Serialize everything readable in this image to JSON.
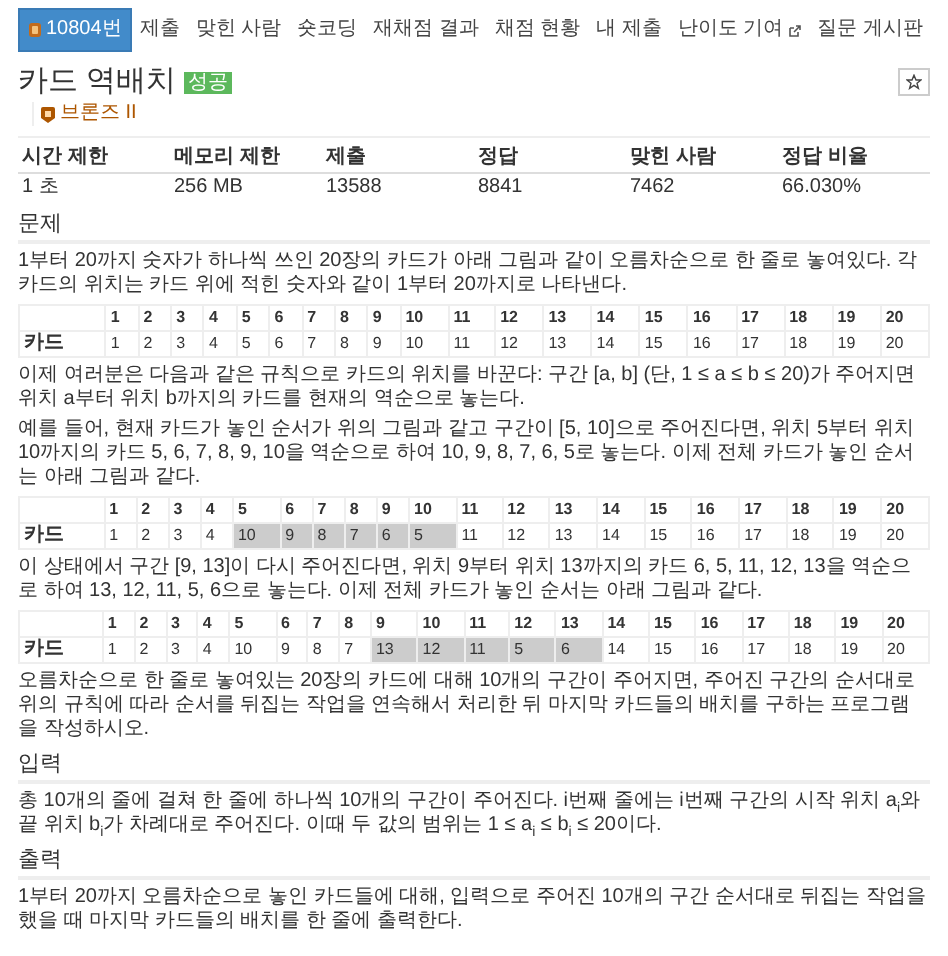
{
  "nav": [
    {
      "label": "10804번",
      "selected": true,
      "external": false
    },
    {
      "label": "제출",
      "selected": false,
      "external": false
    },
    {
      "label": "맞힌 사람",
      "selected": false,
      "external": false
    },
    {
      "label": "숏코딩",
      "selected": false,
      "external": false
    },
    {
      "label": "재채점 결과",
      "selected": false,
      "external": false
    },
    {
      "label": "채점 현황",
      "selected": false,
      "external": false
    },
    {
      "label": "내 제출",
      "selected": false,
      "external": false
    },
    {
      "label": "난이도 기여",
      "selected": false,
      "external": true
    },
    {
      "label": "질문 게시판",
      "selected": false,
      "external": false
    }
  ],
  "problem": {
    "title": "카드 역배치",
    "badge": "성공",
    "tier": "브론즈 II"
  },
  "stats": {
    "columns": [
      "시간 제한",
      "메모리 제한",
      "제출",
      "정답",
      "맞힌 사람",
      "정답 비율"
    ],
    "values": [
      "1 초",
      "256 MB",
      "13588",
      "8841",
      "7462",
      "66.030%"
    ]
  },
  "sections": [
    {
      "heading": "문제",
      "blocks": [
        {
          "kind": "paragraph",
          "text": "1부터 20까지 숫자가 하나씩 쓰인 20장의 카드가 아래 그림과 같이 오름차순으로 한 줄로 놓여있다. 각 카드의 위치는 카드 위에 적힌 숫자와 같이 1부터 20까지로 나타낸다."
        },
        {
          "kind": "table",
          "header": [
            "1",
            "2",
            "3",
            "4",
            "5",
            "6",
            "7",
            "8",
            "9",
            "10",
            "11",
            "12",
            "13",
            "14",
            "15",
            "16",
            "17",
            "18",
            "19",
            "20"
          ],
          "row_label": "카드",
          "cells": [
            {
              "text": "1",
              "highlighted": false
            },
            {
              "text": "2",
              "highlighted": false
            },
            {
              "text": "3",
              "highlighted": false
            },
            {
              "text": "4",
              "highlighted": false
            },
            {
              "text": "5",
              "highlighted": false
            },
            {
              "text": "6",
              "highlighted": false
            },
            {
              "text": "7",
              "highlighted": false
            },
            {
              "text": "8",
              "highlighted": false
            },
            {
              "text": "9",
              "highlighted": false
            },
            {
              "text": "10",
              "highlighted": false
            },
            {
              "text": "11",
              "highlighted": false
            },
            {
              "text": "12",
              "highlighted": false
            },
            {
              "text": "13",
              "highlighted": false
            },
            {
              "text": "14",
              "highlighted": false
            },
            {
              "text": "15",
              "highlighted": false
            },
            {
              "text": "16",
              "highlighted": false
            },
            {
              "text": "17",
              "highlighted": false
            },
            {
              "text": "18",
              "highlighted": false
            },
            {
              "text": "19",
              "highlighted": false
            },
            {
              "text": "20",
              "highlighted": false
            }
          ]
        },
        {
          "kind": "paragraph",
          "text": "이제 여러분은 다음과 같은 규칙으로 카드의 위치를 바꾼다: 구간 [a, b] (단, 1 ≤ a ≤ b ≤ 20)가 주어지면 위치 a부터 위치 b까지의 카드를 현재의 역순으로 놓는다."
        },
        {
          "kind": "paragraph",
          "text": "예를 들어, 현재 카드가 놓인 순서가 위의 그림과 같고 구간이 [5, 10]으로 주어진다면, 위치 5부터 위치 10까지의 카드 5, 6, 7, 8, 9, 10을 역순으로 하여 10, 9, 8, 7, 6, 5로 놓는다. 이제 전체 카드가 놓인 순서는 아래 그림과 같다."
        },
        {
          "kind": "table",
          "header": [
            "1",
            "2",
            "3",
            "4",
            "5",
            "6",
            "7",
            "8",
            "9",
            "10",
            "11",
            "12",
            "13",
            "14",
            "15",
            "16",
            "17",
            "18",
            "19",
            "20"
          ],
          "row_label": "카드",
          "cells": [
            {
              "text": "1",
              "highlighted": false
            },
            {
              "text": "2",
              "highlighted": false
            },
            {
              "text": "3",
              "highlighted": false
            },
            {
              "text": "4",
              "highlighted": false
            },
            {
              "text": "10",
              "highlighted": true
            },
            {
              "text": "9",
              "highlighted": true
            },
            {
              "text": "8",
              "highlighted": true
            },
            {
              "text": "7",
              "highlighted": true
            },
            {
              "text": "6",
              "highlighted": true
            },
            {
              "text": "5",
              "highlighted": true
            },
            {
              "text": "11",
              "highlighted": false
            },
            {
              "text": "12",
              "highlighted": false
            },
            {
              "text": "13",
              "highlighted": false
            },
            {
              "text": "14",
              "highlighted": false
            },
            {
              "text": "15",
              "highlighted": false
            },
            {
              "text": "16",
              "highlighted": false
            },
            {
              "text": "17",
              "highlighted": false
            },
            {
              "text": "18",
              "highlighted": false
            },
            {
              "text": "19",
              "highlighted": false
            },
            {
              "text": "20",
              "highlighted": false
            }
          ]
        },
        {
          "kind": "paragraph",
          "text": "이 상태에서 구간 [9, 13]이 다시 주어진다면, 위치 9부터 위치 13까지의 카드 6, 5, 11, 12, 13을 역순으로 하여 13, 12, 11, 5, 6으로 놓는다. 이제 전체 카드가 놓인 순서는 아래 그림과 같다."
        },
        {
          "kind": "table",
          "header": [
            "1",
            "2",
            "3",
            "4",
            "5",
            "6",
            "7",
            "8",
            "9",
            "10",
            "11",
            "12",
            "13",
            "14",
            "15",
            "16",
            "17",
            "18",
            "19",
            "20"
          ],
          "row_label": "카드",
          "cells": [
            {
              "text": "1",
              "highlighted": false
            },
            {
              "text": "2",
              "highlighted": false
            },
            {
              "text": "3",
              "highlighted": false
            },
            {
              "text": "4",
              "highlighted": false
            },
            {
              "text": "10",
              "highlighted": false
            },
            {
              "text": "9",
              "highlighted": false
            },
            {
              "text": "8",
              "highlighted": false
            },
            {
              "text": "7",
              "highlighted": false
            },
            {
              "text": "13",
              "highlighted": true
            },
            {
              "text": "12",
              "highlighted": true
            },
            {
              "text": "11",
              "highlighted": true
            },
            {
              "text": "5",
              "highlighted": true
            },
            {
              "text": "6",
              "highlighted": true
            },
            {
              "text": "14",
              "highlighted": false
            },
            {
              "text": "15",
              "highlighted": false
            },
            {
              "text": "16",
              "highlighted": false
            },
            {
              "text": "17",
              "highlighted": false
            },
            {
              "text": "18",
              "highlighted": false
            },
            {
              "text": "19",
              "highlighted": false
            },
            {
              "text": "20",
              "highlighted": false
            }
          ]
        },
        {
          "kind": "paragraph",
          "text": "오름차순으로 한 줄로 놓여있는 20장의 카드에 대해 10개의 구간이 주어지면, 주어진 구간의 순서대로 위의 규칙에 따라 순서를 뒤집는 작업을 연속해서 처리한 뒤 마지막 카드들의 배치를 구하는 프로그램을 작성하시오."
        }
      ]
    },
    {
      "heading": "입력",
      "blocks": [
        {
          "kind": "paragraph",
          "text": "총 10개의 줄에 걸쳐 한 줄에 하나씩 10개의 구간이 주어진다. i번째 줄에는 i번째 구간의 시작 위치 a$_{i}$와 끝 위치 b$_{i}$가 차례대로 주어진다. 이때 두 값의 범위는 1 ≤ a$_{i}$ ≤ b$_{i}$ ≤ 20이다."
        }
      ]
    },
    {
      "heading": "출력",
      "blocks": [
        {
          "kind": "paragraph",
          "text": "1부터 20까지 오름차순으로 놓인 카드들에 대해, 입력으로 주어진 10개의 구간 순서대로 뒤집는 작업을 했을 때 마지막 카드들의 배치를 한 줄에 출력한다."
        }
      ]
    }
  ]
}
